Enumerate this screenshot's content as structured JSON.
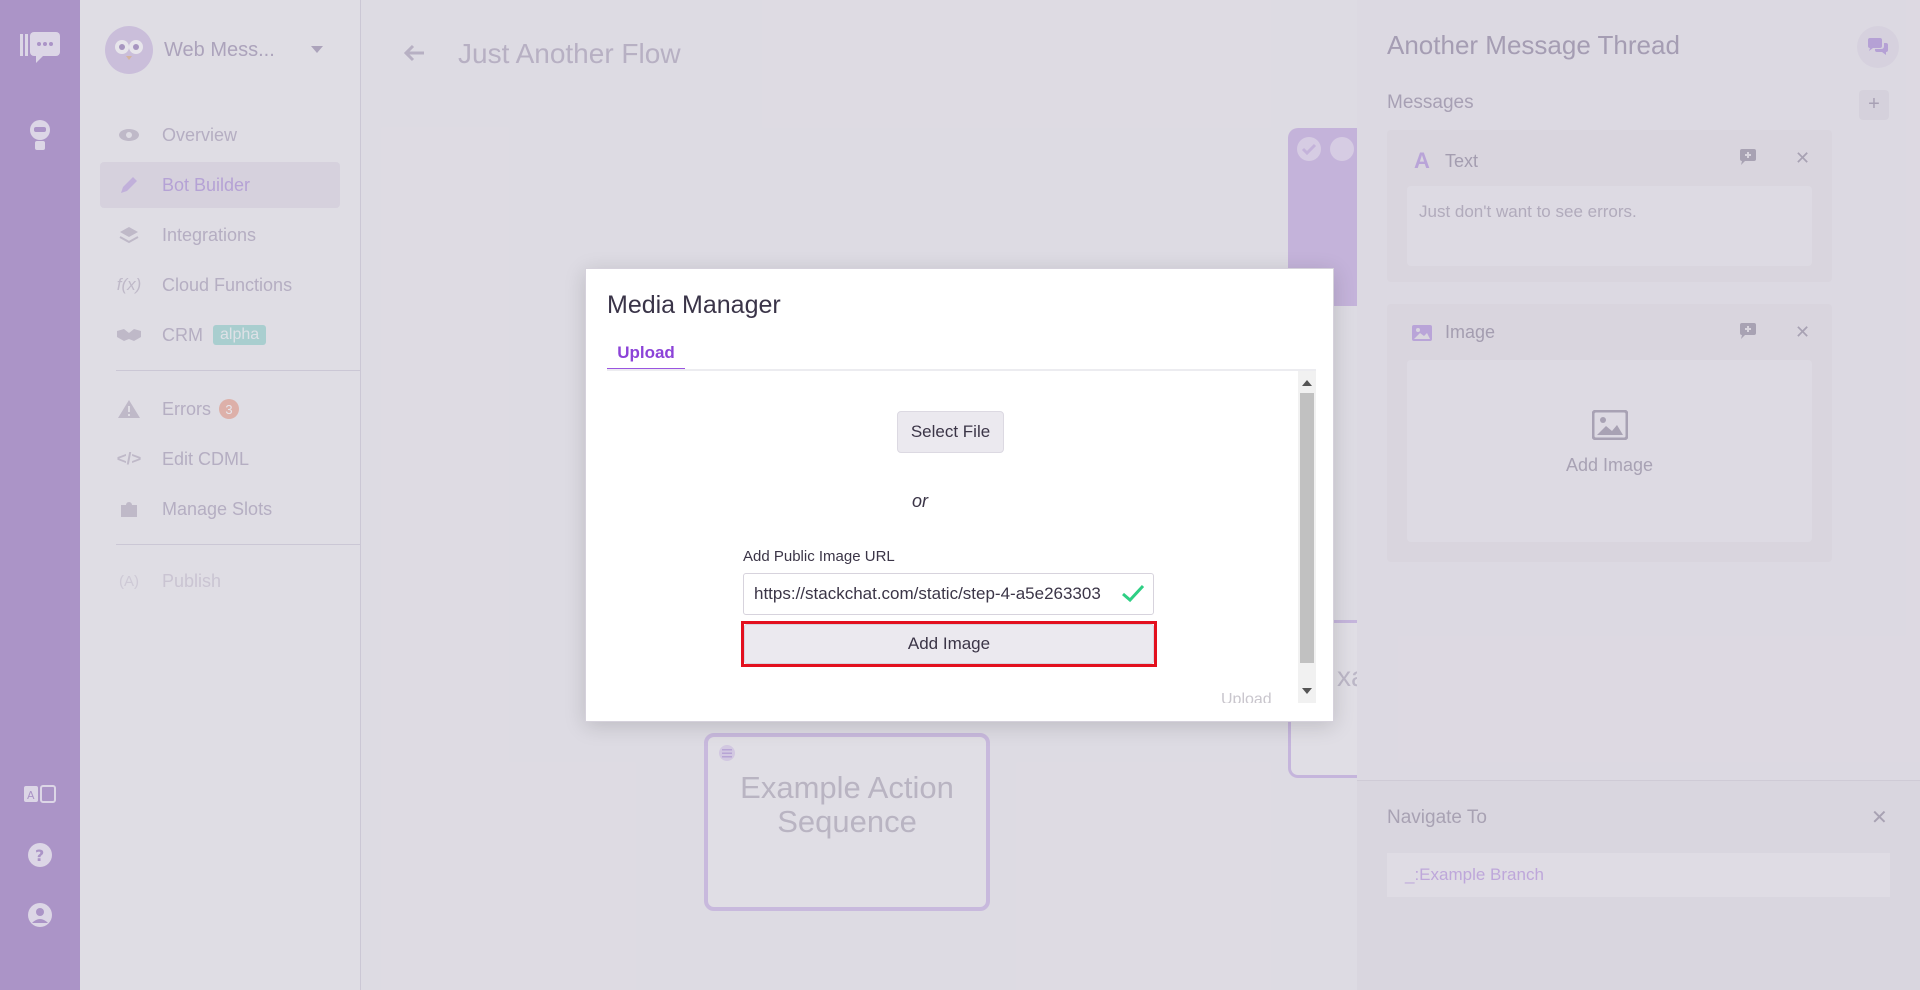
{
  "workspace": {
    "name": "Web Mess..."
  },
  "nav": {
    "items": [
      {
        "label": "Overview",
        "icon": "eye-icon"
      },
      {
        "label": "Bot Builder",
        "icon": "pencil-icon"
      },
      {
        "label": "Integrations",
        "icon": "layers-icon"
      },
      {
        "label": "Cloud Functions",
        "icon": "function-icon"
      },
      {
        "label": "CRM",
        "icon": "handshake-icon",
        "badge": "alpha"
      },
      {
        "label": "Errors",
        "icon": "warning-icon",
        "count": "3"
      },
      {
        "label": "Edit CDML",
        "icon": "code-icon"
      },
      {
        "label": "Manage Slots",
        "icon": "puzzle-icon"
      },
      {
        "label": "Publish",
        "icon": "publish-icon"
      }
    ]
  },
  "header": {
    "title": "Just Another Flow"
  },
  "canvas": {
    "sequence_node": "Example Action Sequence",
    "partial_node_text": "xa"
  },
  "panel": {
    "title": "Another Message Thread",
    "messages_label": "Messages",
    "add_label": "+",
    "text_card": {
      "title": "Text",
      "content": "Just don't want to see errors."
    },
    "image_card": {
      "title": "Image",
      "add_label": "Add Image"
    },
    "navigate": {
      "title": "Navigate To",
      "value": "_:Example Branch",
      "close": "✕"
    }
  },
  "modal": {
    "title": "Media Manager",
    "tab": "Upload",
    "select_file": "Select File",
    "or": "or",
    "url_label": "Add Public Image URL",
    "url_value": "https://stackchat.com/static/step-4-a5e263303",
    "add_image": "Add Image",
    "ghost_upload": "Upload"
  },
  "colors": {
    "accent": "#9a55e0",
    "highlight": "#e3101e",
    "rail": "#bba3d6"
  }
}
